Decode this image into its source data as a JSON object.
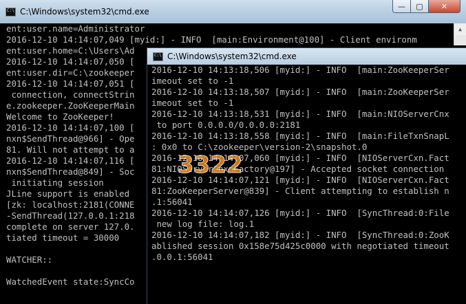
{
  "back_window": {
    "title": "C:\\Windows\\system32\\cmd.exe",
    "lines": [
      "ent:user.name=Administrator",
      "2016-12-10 14:14:07,049 [myid:] - INFO  [main:Environment@100] - Client environm",
      "ent:user.home=C:\\Users\\Ad",
      "2016-12-10 14:14:07,050 [",
      "ent:user.dir=C:\\zookeeper",
      "2016-12-10 14:14:07,051 [",
      " connection, connectStrin",
      "e.zookeeper.ZooKeeperMain",
      "Welcome to ZooKeeper!",
      "2016-12-10 14:14:07,100 [",
      "nxn$SendThread@966] - Ope",
      "81. Will not attempt to a",
      "2016-12-10 14:14:07,116 [",
      "nxn$SendThread@849] - Soc",
      " initiating session",
      "JLine support is enabled",
      "[zk: localhost:2181(CONNE",
      "-SendThread(127.0.0.1:218",
      "complete on server 127.0.",
      "tiated timeout = 30000",
      "",
      "WATCHER::",
      "",
      "WatchedEvent state:SyncCo"
    ]
  },
  "front_window": {
    "title": "C:\\Windows\\system32\\cmd.exe",
    "lines": [
      "2016-12-10 14:13:18,506 [myid:] - INFO  [main:ZooKeeperSer",
      "imeout set to -1",
      "2016-12-10 14:13:18,507 [myid:] - INFO  [main:ZooKeeperSer",
      "imeout set to -1",
      "2016-12-10 14:13:18,531 [myid:] - INFO  [main:NIOServerCnx",
      " to port 0.0.0.0/0.0.0.0:2181",
      "2016-12-10 14:13:18,558 [myid:] - INFO  [main:FileTxnSnapL",
      ": 0x0 to C:\\zookeeper\\version-2\\snapshot.0",
      "2016-12-10 14:14:07,060 [myid:] - INFO  [NIOServerCxn.Fact",
      "81:NIOServerCnxnFactory@197] - Accepted socket connection",
      "2016-12-10 14:14:07,121 [myid:] - INFO  [NIOServerCxn.Fact",
      "81:ZooKeeperServer@839] - Client attempting to establish n",
      ".1:56041",
      "2016-12-10 14:14:07,126 [myid:] - INFO  [SyncThread:0:File",
      " new log file: log.1",
      "2016-12-10 14:14:07,182 [myid:] - INFO  [SyncThread:0:ZooK",
      "ablished session 0x158e75d425c0000 with negotiated timeout",
      ".0.0.1:56041"
    ]
  },
  "window_controls": {
    "minimize": "—",
    "maximize": "▢",
    "close": "✕"
  },
  "watermark": {
    "text": "3322"
  },
  "colors": {
    "console_bg": "#000000",
    "console_text": "#c0c0c0",
    "watermark_orange": "#f08a1c",
    "watermark_blue": "#2a6fc9"
  }
}
